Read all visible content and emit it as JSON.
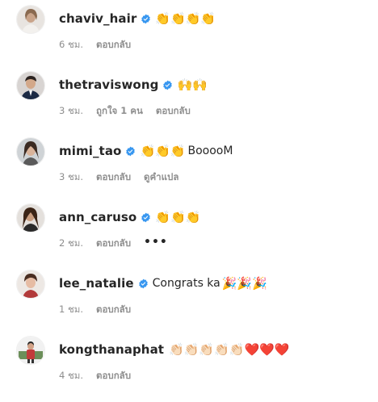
{
  "comments": [
    {
      "username": "chaviv_hair",
      "verified": true,
      "avatar_icon": "profile-photo",
      "text": "",
      "emoji": "👏👏👏👏",
      "time": "6 ชม.",
      "actions": [
        "ตอบกลับ"
      ]
    },
    {
      "username": "thetraviswong",
      "verified": true,
      "avatar_icon": "profile-photo",
      "text": "",
      "emoji": "🙌🙌",
      "time": "3 ชม.",
      "actions": [
        "ถูกใจ 1 คน",
        "ตอบกลับ"
      ]
    },
    {
      "username": "mimi_tao",
      "verified": true,
      "avatar_icon": "profile-photo",
      "text": "BooooM",
      "emoji": "👏👏👏",
      "time": "3 ชม.",
      "actions": [
        "ตอบกลับ",
        "ดูคำแปล"
      ]
    },
    {
      "username": "ann_caruso",
      "verified": true,
      "avatar_icon": "profile-photo",
      "text": "",
      "emoji": "👏👏👏",
      "time": "2 ชม.",
      "actions": [
        "ตอบกลับ"
      ],
      "more": "•••"
    },
    {
      "username": "lee_natalie",
      "verified": true,
      "avatar_icon": "profile-photo",
      "text": "Congrats ka",
      "emoji": "🎉🎉🎉",
      "time": "1 ชม.",
      "actions": [
        "ตอบกลับ"
      ]
    },
    {
      "username": "kongthanaphat",
      "verified": false,
      "avatar_icon": "profile-photo",
      "text": "",
      "emoji": "👏🏻👏🏻👏🏻👏🏻👏🏻❤️❤️❤️",
      "time": "4 ชม.",
      "actions": [
        "ตอบกลับ"
      ]
    }
  ],
  "colors": {
    "verified_badge": "#3897f0",
    "meta_text": "#8e8e8e",
    "username_text": "#262626"
  }
}
